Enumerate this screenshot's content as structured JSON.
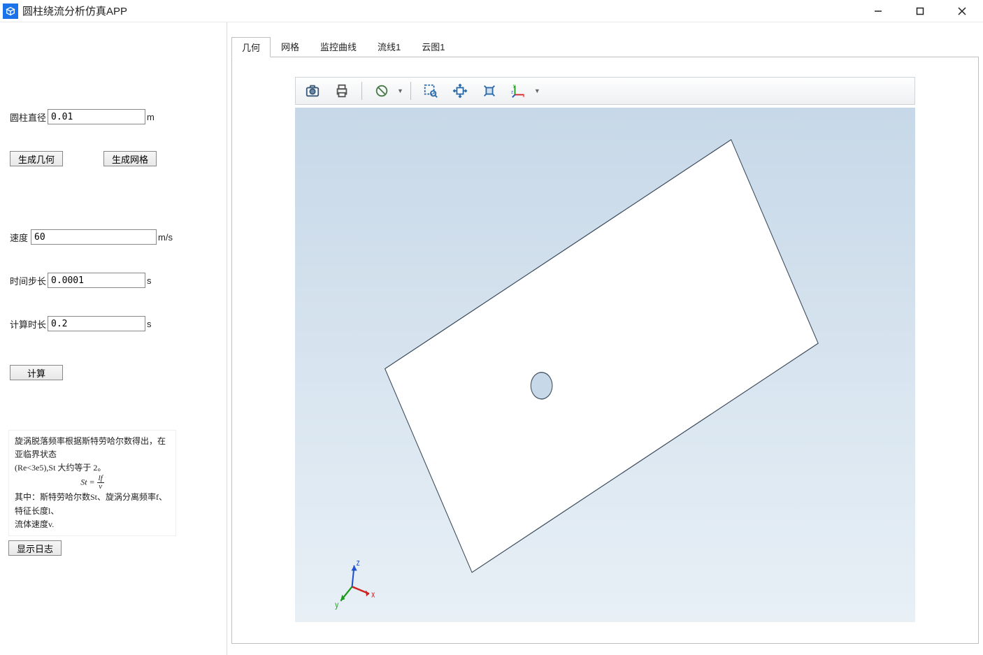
{
  "window": {
    "title": "圆柱绕流分析仿真APP"
  },
  "sidebar": {
    "diameter_label": "圆柱直径",
    "diameter_value": "0.01",
    "diameter_unit": "m",
    "gen_geom_button": "生成几何",
    "gen_mesh_button": "生成网格",
    "velocity_label": "速度",
    "velocity_value": "60",
    "velocity_unit": "m/s",
    "timestep_label": "时间步长",
    "timestep_value": "0.0001",
    "timestep_unit": "s",
    "duration_label": "计算时长",
    "duration_value": "0.2",
    "duration_unit": "s",
    "compute_button": "计算",
    "info_line1": "旋涡脱落频率根据斯特劳哈尔数得出，在亚临界状态",
    "info_line2": "(Re<3e5),St 大约等于 2。",
    "info_formula_lhs": "St =",
    "info_formula_num": "lf",
    "info_formula_den": "v",
    "info_line3": "其中：斯特劳哈尔数St、旋涡分离频率f、特征长度l、",
    "info_line4": "流体速度v.",
    "show_log_button": "显示日志"
  },
  "tabs": {
    "items": [
      "几何",
      "网格",
      "监控曲线",
      "流线1",
      "云图1"
    ],
    "active": 0
  },
  "toolbar": {
    "icons": [
      "camera-icon",
      "print-icon",
      "forbid-icon",
      "zoom-box-icon",
      "pan-icon",
      "fit-icon",
      "axis-icon"
    ]
  }
}
